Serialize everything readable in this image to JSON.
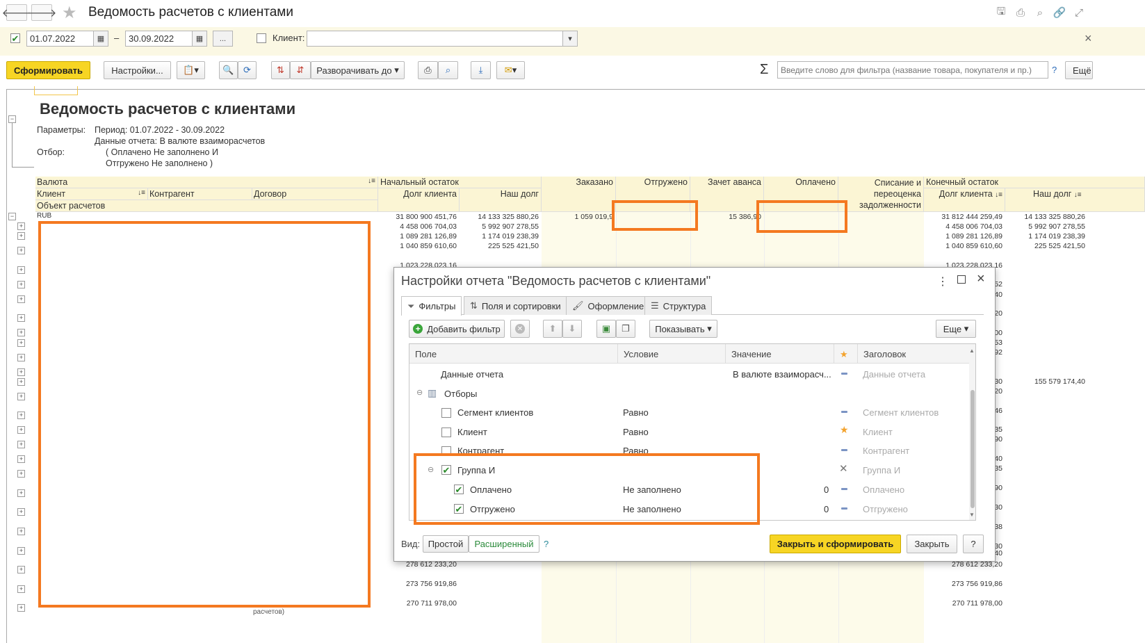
{
  "window": {
    "title": "Ведомость расчетов с клиентами",
    "back": "🡐",
    "forward": "🡒"
  },
  "filter": {
    "date_from": "01.07.2022",
    "date_to": "30.09.2022",
    "dash": "–",
    "more": "...",
    "client_label": "Клиент:",
    "client_value": ""
  },
  "toolbar": {
    "generate": "Сформировать",
    "settings": "Настройки...",
    "expand_to": "Разворачивать до",
    "search_placeholder": "Введите слово для фильтра (название товара, покупателя и пр.)",
    "help": "?",
    "more": "Ещё",
    "sigma": "Σ"
  },
  "report": {
    "title": "Ведомость расчетов с клиентами",
    "params_label": "Параметры:",
    "period": "Период: 01.07.2022 - 30.09.2022",
    "data": "Данные отчета: В валюте взаиморасчетов",
    "filter_label": "Отбор:",
    "filter1": "( Оплачено Не заполнено И",
    "filter2": "Отгружено Не заполнено )",
    "headers": {
      "currency": "Валюта",
      "client": "Клиент",
      "counterparty": "Контрагент",
      "contract": "Договор",
      "object": "Объект расчетов",
      "start_balance": "Начальный остаток",
      "client_debt": "Долг клиента",
      "our_debt": "Наш долг",
      "ordered": "Заказано",
      "shipped": "Отгружено",
      "advance": "Зачет аванса",
      "paid": "Оплачено",
      "writeoff": "Списание и переоценка задолженности",
      "end_balance": "Конечный остаток",
      "client_debt2": "Долг клиента",
      "our_debt2": "Наш долг"
    },
    "rub_label": "RUB",
    "rows": [
      {
        "c1": "31 800 900 451,76",
        "c2": "14 133 325 880,26",
        "c3": "1 059 019,9",
        "c5": "15 386,90",
        "c8": "31 812 444 259,49",
        "c9": "14 133 325 880,26"
      },
      {
        "c1": "4 458 006 704,03",
        "c2": "5 992 907 278,55",
        "c8": "4 458 006 704,03",
        "c9": "5 992 907 278,55"
      },
      {
        "c1": "1 089 281 126,89",
        "c2": "1 174 019 238,39",
        "c8": "1 089 281 126,89",
        "c9": "1 174 019 238,39"
      },
      {
        "c1": "1 040 859 610,60",
        "c2": "225 525 421,50",
        "c8": "1 040 859 610,60",
        "c9": "225 525 421,50"
      },
      {
        "c1": "1 023 228 023,16",
        "c8": "1 023 228 023,16"
      }
    ],
    "bottom_rows": [
      {
        "c1": "278 612 233,20",
        "c8": "278 612 233,20"
      },
      {
        "c1": "273 756 919,86",
        "c8": "273 756 919,86"
      },
      {
        "c1": "270 711 978,00",
        "c8": "270 711 978,00"
      }
    ],
    "right_partial": [
      "52",
      "40",
      "20",
      "00",
      "53",
      "92",
      "30",
      "20",
      "46",
      "35",
      "90",
      "40",
      "35",
      "90",
      "30",
      "38",
      "30",
      "40"
    ],
    "right_partial_extra": "155 579 174,40",
    "bottom_text": "расчетов)"
  },
  "dialog": {
    "title": "Настройки отчета \"Ведомость расчетов с клиентами\"",
    "tabs": [
      "Фильтры",
      "Поля и сортировки",
      "Оформление",
      "Структура"
    ],
    "add_filter": "Добавить фильтр",
    "show": "Показывать",
    "more": "Еще",
    "cols": {
      "field": "Поле",
      "condition": "Условие",
      "value": "Значение",
      "title": "Заголовок"
    },
    "rows": {
      "data": {
        "field": "Данные отчета",
        "value": "В валюте взаиморасч...",
        "title": "Данные отчета"
      },
      "filters": {
        "field": "Отборы"
      },
      "segment": {
        "field": "Сегмент клиентов",
        "cond": "Равно",
        "title": "Сегмент клиентов"
      },
      "client": {
        "field": "Клиент",
        "cond": "Равно",
        "title": "Клиент"
      },
      "contractor": {
        "field": "Контрагент",
        "cond": "Равно",
        "title": "Контрагент"
      },
      "group": {
        "field": "Группа И",
        "title": "Группа И"
      },
      "paid": {
        "field": "Оплачено",
        "cond": "Не заполнено",
        "value": "0",
        "title": "Оплачено"
      },
      "shipped": {
        "field": "Отгружено",
        "cond": "Не заполнено",
        "value": "0",
        "title": "Отгружено"
      }
    },
    "view_label": "Вид:",
    "simple": "Простой",
    "extended": "Расширенный",
    "help": "?",
    "close_generate": "Закрыть и сформировать",
    "close": "Закрыть"
  },
  "colors": {
    "highlight": "#f47920",
    "accent_yellow": "#f7d524",
    "header_bg": "#fbf5d4",
    "filter_bg": "#fbf8e4"
  }
}
